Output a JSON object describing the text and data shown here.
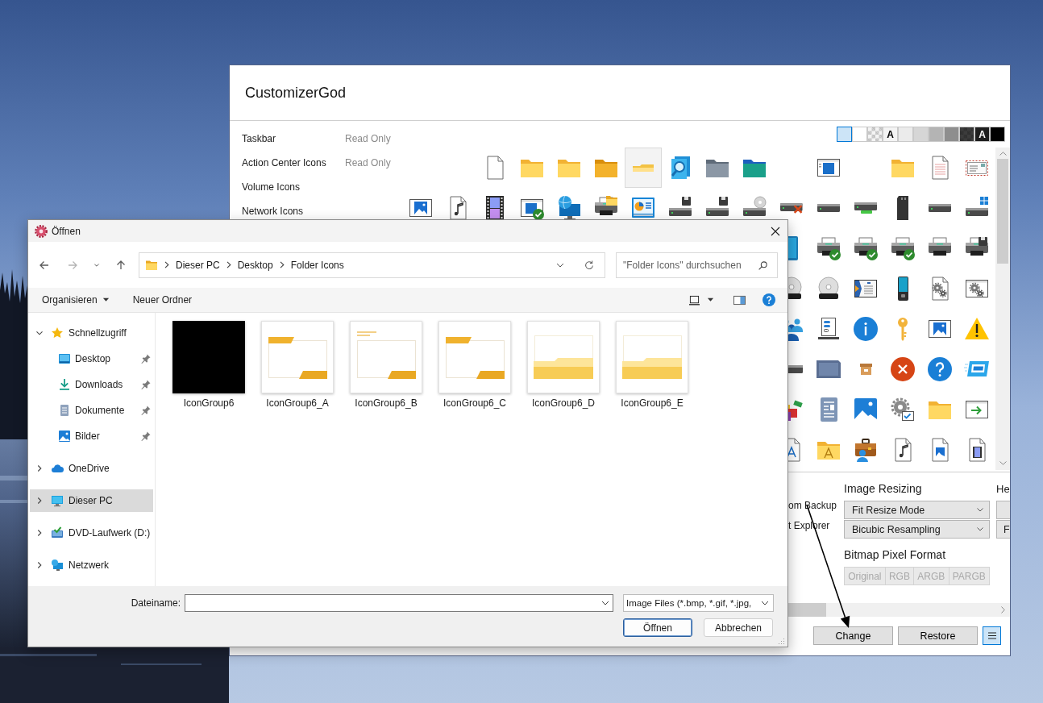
{
  "customizer_window": {
    "title": "CustomizerGod",
    "categories": [
      {
        "label": "Taskbar",
        "status": "Read Only"
      },
      {
        "label": "Action Center Icons",
        "status": "Read Only"
      },
      {
        "label": "Volume Icons"
      },
      {
        "label": "Network Icons"
      }
    ],
    "background_swatches": [
      {
        "kind": "solid",
        "color": "#cce4f7",
        "selected": true
      },
      {
        "kind": "solid",
        "color": "#ffffff",
        "selected": false
      },
      {
        "kind": "checker",
        "color": "#f4f4f4",
        "selected": false
      },
      {
        "kind": "letter",
        "color": "#f4f4f4",
        "label": "A",
        "selected": false
      },
      {
        "kind": "solid",
        "color": "#ebebeb",
        "selected": false
      },
      {
        "kind": "solid",
        "color": "#d6d6d6",
        "selected": false
      },
      {
        "kind": "solid",
        "color": "#b4b4b4",
        "selected": false
      },
      {
        "kind": "solid",
        "color": "#8e8e8e",
        "selected": false
      },
      {
        "kind": "checker",
        "color": "#3c3c3c",
        "selected": false
      },
      {
        "kind": "letter",
        "color": "#1e1e1e",
        "label": "A",
        "selected": false
      },
      {
        "kind": "solid",
        "color": "#000000",
        "selected": false
      }
    ],
    "icon_grid": {
      "rows": [
        {
          "icons": [
            {
              "kind": "page",
              "selected": false
            },
            {
              "kind": "folder",
              "selected": false
            },
            {
              "kind": "folder",
              "selected": false
            },
            {
              "kind": "deepfolder",
              "selected": false
            },
            {
              "kind": "flatfolder",
              "selected": true
            },
            {
              "kind": "search",
              "selected": false
            },
            {
              "kind": "slatefolder",
              "selected": false
            },
            {
              "kind": "tealfolder",
              "selected": false
            },
            {
              "kind": "blank",
              "selected": false
            },
            {
              "kind": "window",
              "selected": false
            },
            {
              "kind": "blank",
              "selected": false
            },
            {
              "kind": "folder",
              "selected": false
            },
            {
              "kind": "notepad",
              "selected": false
            },
            {
              "kind": "envelope",
              "selected": false
            }
          ]
        },
        {
          "icons": [
            {
              "kind": "picture",
              "selected": false
            },
            {
              "kind": "music",
              "selected": false
            },
            {
              "kind": "film",
              "selected": false
            },
            {
              "kind": "windowcheck",
              "selected": false
            },
            {
              "kind": "globe",
              "selected": false
            },
            {
              "kind": "printerfolder",
              "selected": false
            },
            {
              "kind": "chart",
              "selected": false
            },
            {
              "kind": "floppydrive",
              "selected": false
            },
            {
              "kind": "floppydrive",
              "selected": false
            },
            {
              "kind": "discdrive",
              "selected": false
            },
            {
              "kind": "faileddrive",
              "selected": false
            },
            {
              "kind": "drive",
              "selected": false
            },
            {
              "kind": "usbdrive",
              "selected": false
            },
            {
              "kind": "chip",
              "selected": false
            },
            {
              "kind": "drive",
              "selected": false
            },
            {
              "kind": "windrive",
              "selected": false
            }
          ]
        },
        {
          "icons": [
            {
              "kind": "tablet",
              "selected": false
            },
            {
              "kind": "printercheck",
              "selected": false
            },
            {
              "kind": "printercheck",
              "selected": false
            },
            {
              "kind": "printercheck",
              "selected": false
            },
            {
              "kind": "printer",
              "selected": false
            },
            {
              "kind": "printerfloppy",
              "selected": false
            }
          ]
        },
        {
          "icons": [
            {
              "kind": "disc",
              "selected": false
            },
            {
              "kind": "disc",
              "selected": false
            },
            {
              "kind": "contact",
              "selected": false
            },
            {
              "kind": "player",
              "selected": false
            },
            {
              "kind": "gearpage",
              "selected": false
            },
            {
              "kind": "gearwindow",
              "selected": false
            }
          ]
        },
        {
          "icons": [
            {
              "kind": "people",
              "selected": false
            },
            {
              "kind": "serverlist",
              "selected": false
            },
            {
              "kind": "info",
              "selected": false
            },
            {
              "kind": "key",
              "selected": false
            },
            {
              "kind": "picture",
              "selected": false
            },
            {
              "kind": "warning",
              "selected": false
            }
          ]
        },
        {
          "icons": [
            {
              "kind": "drive",
              "selected": false
            },
            {
              "kind": "slate",
              "selected": false
            },
            {
              "kind": "archive",
              "selected": false
            },
            {
              "kind": "error",
              "selected": false
            },
            {
              "kind": "help",
              "selected": false
            },
            {
              "kind": "display",
              "selected": false
            }
          ]
        },
        {
          "icons": [
            {
              "kind": "blocks",
              "selected": false
            },
            {
              "kind": "article",
              "selected": false
            },
            {
              "kind": "photo",
              "selected": false
            },
            {
              "kind": "gearcheck",
              "selected": false
            },
            {
              "kind": "folder",
              "selected": false
            },
            {
              "kind": "exitwindow",
              "selected": false
            }
          ]
        },
        {
          "icons": [
            {
              "kind": "fontpage",
              "selected": false
            },
            {
              "kind": "fontfolder",
              "selected": false
            },
            {
              "kind": "briefcase",
              "selected": false
            },
            {
              "kind": "music",
              "selected": false
            },
            {
              "kind": "picturepage",
              "selected": false
            },
            {
              "kind": "videopage",
              "selected": false
            }
          ]
        }
      ]
    },
    "options": [
      "om Backup",
      "t Explorer"
    ],
    "image_resizing": {
      "heading": "Image Resizing",
      "dropdowns": [
        "Fit Resize Mode",
        "Bicubic Resampling"
      ]
    },
    "bitmap_pixel_format": {
      "heading": "Bitmap Pixel Format",
      "disabled": true,
      "options": [
        "Original",
        "RGB",
        "ARGB",
        "PARGB"
      ]
    },
    "column_3": {
      "heading": "He",
      "fields": [
        {
          "kind": "dropdown"
        },
        {
          "kind": "dropdown",
          "value": "F"
        }
      ]
    },
    "buttons": [
      "Change",
      "Restore"
    ],
    "menu_button": {
      "pressed": true
    }
  },
  "open_dialog": {
    "title": "Öffnen",
    "nav_buttons": [
      {
        "kind": "back",
        "disabled": false
      },
      {
        "kind": "forward",
        "disabled": true
      },
      {
        "kind": "recent",
        "disabled": false
      },
      {
        "kind": "up",
        "disabled": false
      }
    ],
    "path": [
      "Dieser PC",
      "Desktop",
      "Folder Icons"
    ],
    "search": {
      "placeholder": "\"Folder Icons\" durchsuchen"
    },
    "commands": [
      {
        "label": "Organisieren",
        "menu": true
      },
      {
        "label": "Neuer Ordner",
        "menu": false
      }
    ],
    "navigation": [
      {
        "label": "Schnellzugriff",
        "kind": "star",
        "expanded": true,
        "selected": false,
        "children": [
          {
            "label": "Desktop",
            "kind": "desktop",
            "pinned": true,
            "selected": false
          },
          {
            "label": "Downloads",
            "kind": "downloads",
            "pinned": true,
            "selected": false
          },
          {
            "label": "Dokumente",
            "kind": "documents",
            "pinned": true,
            "selected": false
          },
          {
            "label": "Bilder",
            "kind": "pictures",
            "pinned": true,
            "selected": false
          }
        ]
      },
      {
        "label": "OneDrive",
        "kind": "cloud",
        "expanded": false,
        "selected": false
      },
      {
        "label": "Dieser PC",
        "kind": "computer",
        "expanded": false,
        "selected": true
      },
      {
        "label": "DVD-Laufwerk (D:)",
        "kind": "dvd",
        "expanded": false,
        "selected": false
      },
      {
        "label": "Netzwerk",
        "kind": "network",
        "expanded": false,
        "selected": false
      }
    ],
    "files": [
      {
        "name": "IconGroup6",
        "kind": "dark",
        "selected": false
      },
      {
        "name": "IconGroup6_A",
        "kind": "outline",
        "selected": false
      },
      {
        "name": "IconGroup6_B",
        "kind": "lined",
        "selected": false
      },
      {
        "name": "IconGroup6_C",
        "kind": "outline",
        "selected": false
      },
      {
        "name": "IconGroup6_D",
        "kind": "solid",
        "selected": false
      },
      {
        "name": "IconGroup6_E",
        "kind": "solid",
        "selected": false
      }
    ],
    "file_name": {
      "label": "Dateiname:"
    },
    "file_type": {
      "value": "Image Files (*.bmp, *.gif, *.jpg,"
    },
    "buttons": [
      {
        "label": "Öffnen",
        "default": true
      },
      {
        "label": "Abbrechen",
        "default": false
      }
    ]
  }
}
